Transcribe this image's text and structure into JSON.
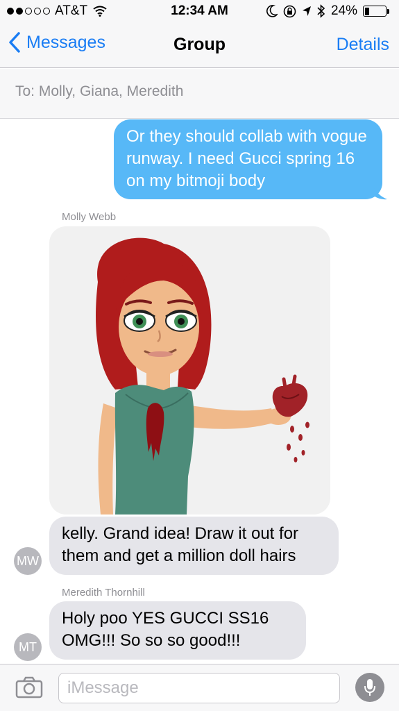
{
  "status_bar": {
    "carrier": "AT&T",
    "time": "12:34 AM",
    "battery_percent": "24%",
    "battery_level": 0.24,
    "icons": [
      "signal-dots-icon",
      "wifi-icon",
      "moon-icon",
      "rotation-lock-icon",
      "location-arrow-icon",
      "bluetooth-icon",
      "battery-icon"
    ]
  },
  "nav": {
    "back_label": "Messages",
    "title": "Group",
    "details_label": "Details"
  },
  "recipients": {
    "text": "To: Molly, Giana, Meredith"
  },
  "messages": [
    {
      "type": "outgoing",
      "text": "Or they should collab with vogue runway. I need Gucci spring 16 on my bitmoji body"
    },
    {
      "type": "incoming",
      "sender": "Molly Webb",
      "image": "bitmoji-heart-sticker"
    },
    {
      "type": "incoming",
      "initials": "MW",
      "text": "kelly. Grand idea! Draw it out for them and get a million doll hairs"
    },
    {
      "type": "incoming",
      "sender": "Meredith Thornhill",
      "initials": "MT",
      "text": "Holy poo YES GUCCI SS16 OMG!!! So so so good!!!"
    }
  ],
  "input": {
    "placeholder": "iMessage"
  },
  "colors": {
    "accent": "#1a7df4",
    "outgoing_bubble": "#57b8f7",
    "incoming_bubble": "#e5e5ea",
    "bar_background": "#f7f7f8"
  }
}
